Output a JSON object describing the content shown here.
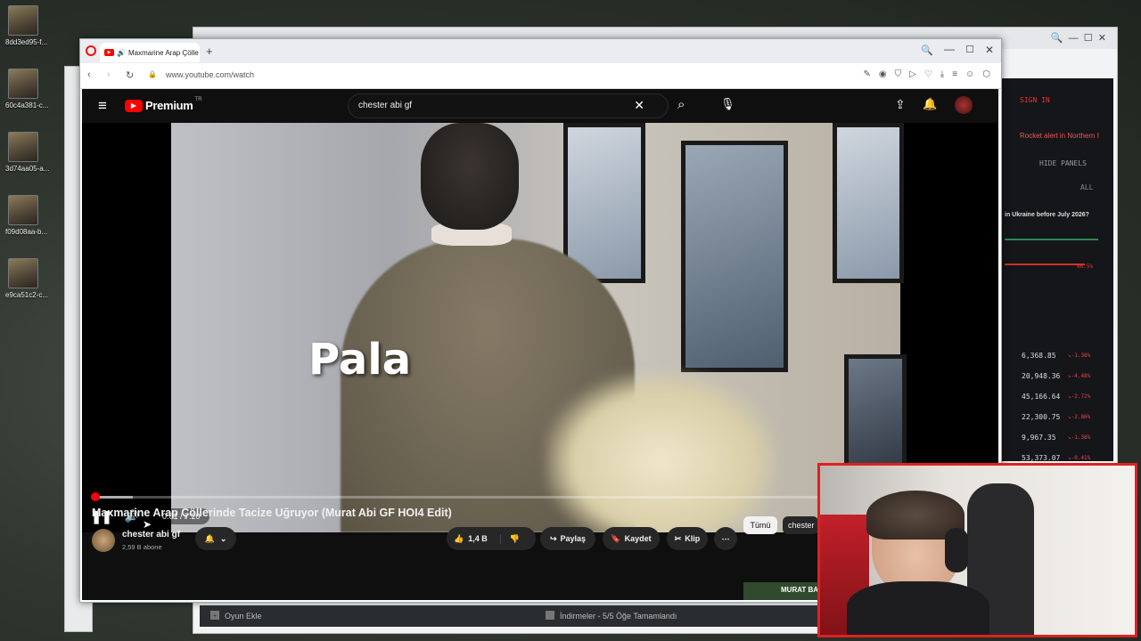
{
  "desktop": {
    "icons": [
      {
        "label": "8dd3ed95-f..."
      },
      {
        "label": "60c4a381-c..."
      },
      {
        "label": "3d74aa05-a..."
      },
      {
        "label": "f09d08aa-b..."
      },
      {
        "label": "e9ca51c2-c..."
      }
    ]
  },
  "right_panel": {
    "sign_in": "SIGN IN",
    "alert": "Rocket alert in Northern I",
    "hide_panels": "HIDE PANELS",
    "all": "ALL",
    "question": "in Ukraine before July 2026?",
    "percent": "86.5%",
    "values": [
      {
        "value": "6,368.85",
        "change": "-1.38%"
      },
      {
        "value": "20,948.36",
        "change": "-4.48%"
      },
      {
        "value": "45,166.64",
        "change": "-2.72%"
      },
      {
        "value": "22,300.75",
        "change": "-2.86%"
      },
      {
        "value": "9,967.35",
        "change": "-1.38%"
      },
      {
        "value": "53,373.07",
        "change": "-0.41%"
      }
    ]
  },
  "browser": {
    "tab_title": "Maxmarine Arap Çölle",
    "url": "www.youtube.com/watch"
  },
  "youtube": {
    "logo_text": "Premium",
    "region": "TR",
    "search_query": "chester abi gf",
    "caption": "Pala",
    "time_current": "0:01",
    "time_total": "7:20",
    "progress": 0.003,
    "buffered": 0.045,
    "video_title": "Maxmarine Arap Çöllerinde Tacize Uğruyor (Murat Abi GF HOI4 Edit)",
    "channel_name": "chester abi gf",
    "subscribers": "2,59 B abone",
    "likes": "1,4 B",
    "share": "Paylaş",
    "save": "Kaydet",
    "clip": "Klip",
    "chip_all": "Tümü",
    "chip_channel": "chester",
    "thumb_text": "MURAT BA"
  },
  "taskbar": {
    "add_game": "Oyun Ekle",
    "downloads": "İndirmeler - 5/5 Öğe Tamamlandı"
  },
  "colors": {
    "accent": "#ff0000",
    "cam_border": "#e02020"
  }
}
